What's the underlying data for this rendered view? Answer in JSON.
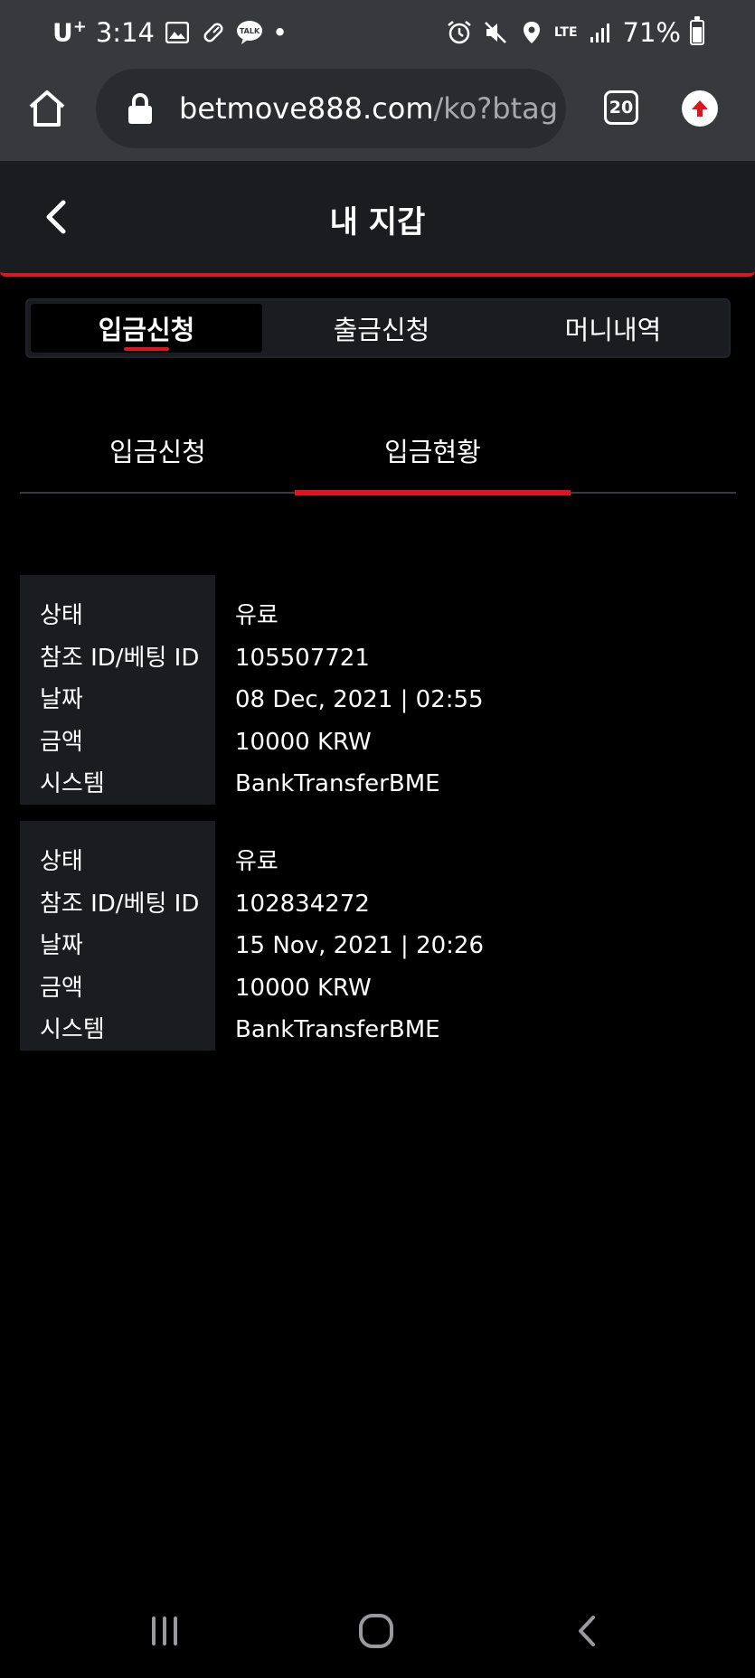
{
  "status_bar": {
    "carrier": "U",
    "carrier_sup": "+",
    "time": "3:14",
    "dot": "•",
    "network": "LTE",
    "battery": "71%",
    "left_icons": [
      "image-icon",
      "pill-icon",
      "talk-icon"
    ],
    "right_icons": [
      "alarm-icon",
      "mute-icon",
      "location-icon",
      "signal-icon"
    ]
  },
  "browser": {
    "url_domain": "betmove888.com",
    "url_path": "/ko?btag",
    "tab_count": "20"
  },
  "header": {
    "title": "내 지갑"
  },
  "main_tabs": [
    {
      "label": "입금신청"
    },
    {
      "label": "출금신청"
    },
    {
      "label": "머니내역"
    }
  ],
  "sub_tabs": [
    {
      "label": "입금신청"
    },
    {
      "label": "입금현황"
    }
  ],
  "records": [
    {
      "rows": [
        {
          "label": "상태",
          "value": "유료"
        },
        {
          "label": "참조 ID/베팅 ID",
          "value": "105507721"
        },
        {
          "label": "날짜",
          "value": "08 Dec, 2021 | 02:55"
        },
        {
          "label": "금액",
          "value": "10000 KRW"
        },
        {
          "label": "시스템",
          "value": "BankTransferBME"
        }
      ]
    },
    {
      "rows": [
        {
          "label": "상태",
          "value": "유료"
        },
        {
          "label": "참조 ID/베팅 ID",
          "value": "102834272"
        },
        {
          "label": "날짜",
          "value": "15 Nov, 2021 | 20:26"
        },
        {
          "label": "금액",
          "value": "10000 KRW"
        },
        {
          "label": "시스템",
          "value": "BankTransferBME"
        }
      ]
    }
  ],
  "colors": {
    "accent": "#e0141e",
    "chrome": "#38393d",
    "panel": "#1b1c20"
  }
}
